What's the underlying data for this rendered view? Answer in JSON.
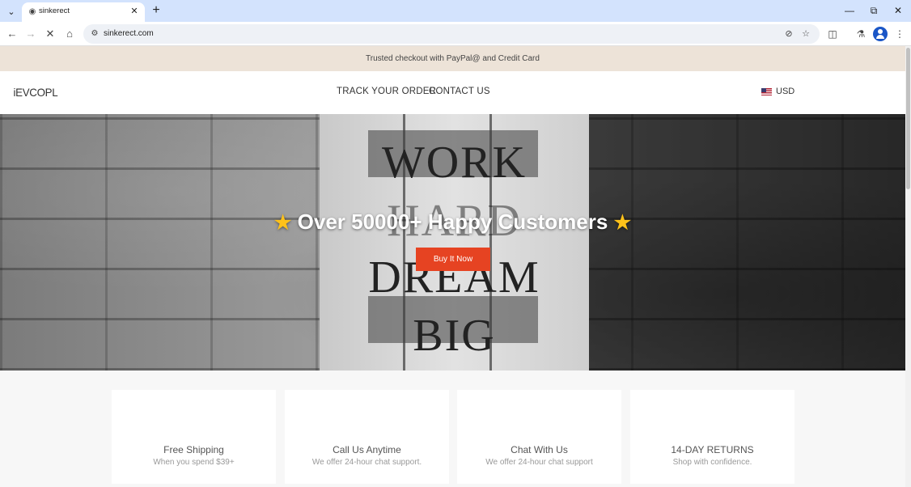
{
  "browser": {
    "tab_title": "sinkerect",
    "url": "sinkerect.com",
    "icons": [
      "tab-list-icon",
      "favicon-icon",
      "close-icon",
      "new-tab-icon",
      "minimize-icon",
      "restore-icon",
      "window-close-icon",
      "back-icon",
      "forward-icon",
      "stop-loading-icon",
      "home-icon",
      "site-info-icon",
      "eye-off-icon",
      "bookmark-star-icon",
      "extensions-icon",
      "labs-icon",
      "profile-icon",
      "menu-icon"
    ]
  },
  "announcement": {
    "text": "Trusted checkout with PayPal@ and Credit Card"
  },
  "header": {
    "logo": "iEVCOPL",
    "nav": [
      "TRACK YOUR ORDER",
      "CONTACT US"
    ],
    "currency": "USD"
  },
  "hero": {
    "headline": "Over 50000+ Happy Customers",
    "sign_words": [
      "WORK",
      "HARD",
      "DREAM",
      "BIG"
    ],
    "button": "Buy It Now",
    "colors": {
      "button": "#e64322",
      "star": "#ffc21a"
    }
  },
  "features": [
    {
      "title": "Free Shipping",
      "subtitle": "When you spend $39+"
    },
    {
      "title": "Call Us Anytime",
      "subtitle": "We offer 24-hour chat support."
    },
    {
      "title": "Chat With Us",
      "subtitle": "We offer 24-hour chat support"
    },
    {
      "title": "14-DAY RETURNS",
      "subtitle": "Shop with confidence."
    }
  ]
}
